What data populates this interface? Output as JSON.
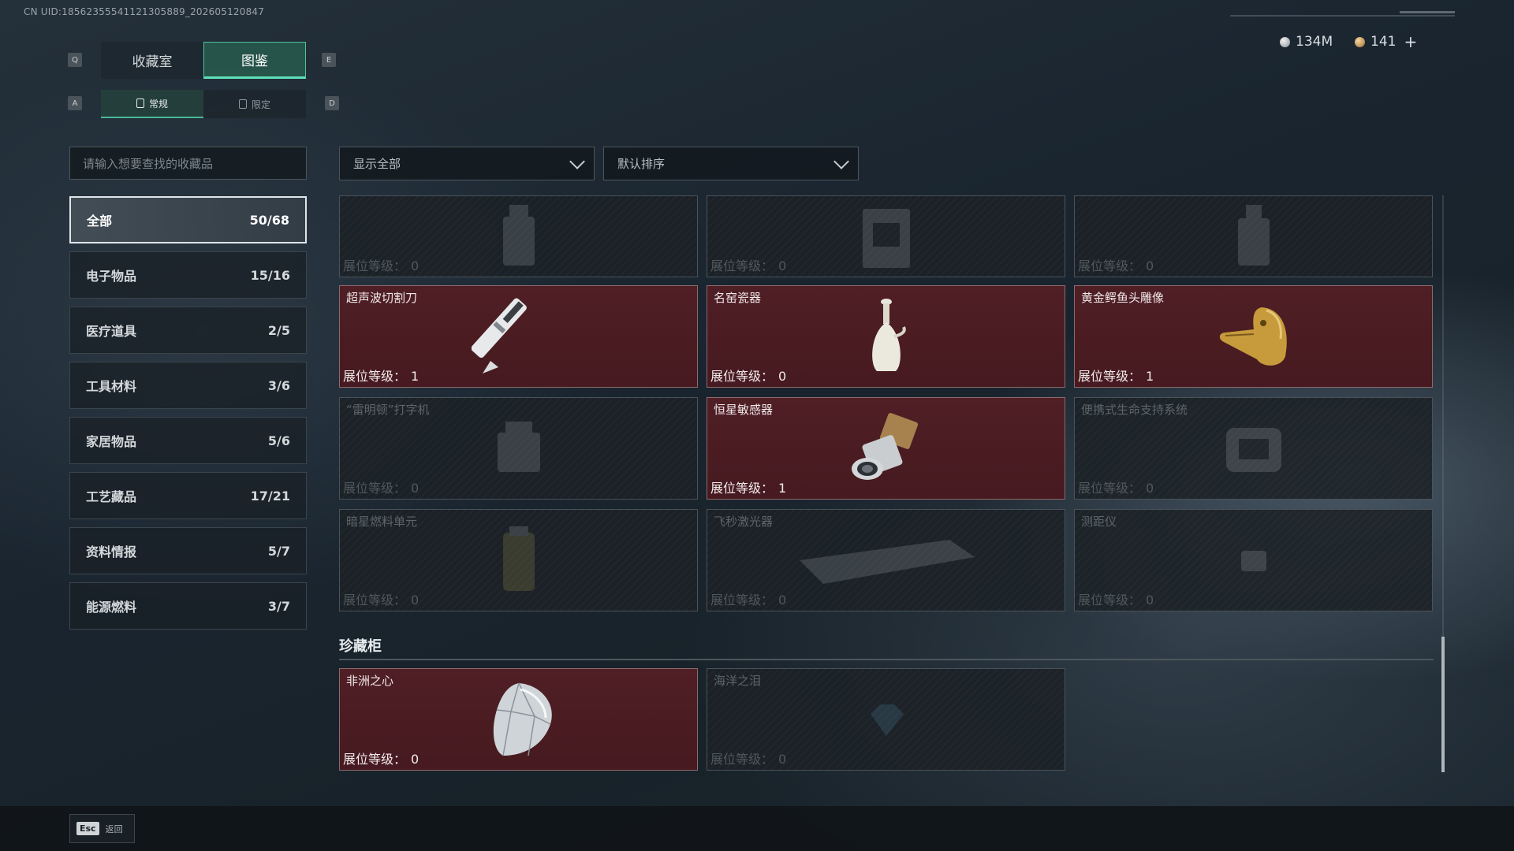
{
  "uid_text": "CN UID:185623555411213058​89_202605120847",
  "currency": {
    "silver": {
      "icon": "silver-coin-icon",
      "value": "134M"
    },
    "gold": {
      "icon": "gold-coin-icon",
      "value": "141",
      "add_label": "+"
    }
  },
  "tabs": {
    "left_key": "Q",
    "right_key": "E",
    "items": [
      {
        "label": "收藏室",
        "active": false
      },
      {
        "label": "图鉴",
        "active": true
      }
    ]
  },
  "subtabs": {
    "left_key": "A",
    "right_key": "D",
    "items": [
      {
        "label": "常规",
        "icon": "regular-icon",
        "active": true
      },
      {
        "label": "限定",
        "icon": "limited-icon",
        "active": false
      }
    ]
  },
  "search": {
    "placeholder": "请输入想要查找的收藏品"
  },
  "categories": [
    {
      "label": "全部",
      "count": "50/68",
      "active": true
    },
    {
      "label": "电子物品",
      "count": "15/16",
      "active": false
    },
    {
      "label": "医疗道具",
      "count": "2/5",
      "active": false
    },
    {
      "label": "工具材料",
      "count": "3/6",
      "active": false
    },
    {
      "label": "家居物品",
      "count": "5/6",
      "active": false
    },
    {
      "label": "工艺藏品",
      "count": "17/21",
      "active": false
    },
    {
      "label": "资料情报",
      "count": "5/7",
      "active": false
    },
    {
      "label": "能源燃料",
      "count": "3/7",
      "active": false
    }
  ],
  "filters": {
    "show": "显示全部",
    "sort": "默认排序"
  },
  "level_label": "展位等级：",
  "grid_items": [
    {
      "name": "",
      "level": "0",
      "owned": false,
      "art": "bottle-icon"
    },
    {
      "name": "",
      "level": "0",
      "owned": false,
      "art": "device-icon"
    },
    {
      "name": "",
      "level": "0",
      "owned": false,
      "art": "bottle-icon"
    },
    {
      "name": "超声波切割刀",
      "level": "1",
      "owned": true,
      "art": "ultrasonic-knife-icon"
    },
    {
      "name": "名窑瓷器",
      "level": "0",
      "owned": true,
      "art": "porcelain-vase-icon"
    },
    {
      "name": "黄金鳄鱼头雕像",
      "level": "1",
      "owned": true,
      "art": "golden-crocodile-icon"
    },
    {
      "name": "“雷明顿”打字机",
      "level": "0",
      "owned": false,
      "art": "typewriter-icon"
    },
    {
      "name": "恒星敏感器",
      "level": "1",
      "owned": true,
      "art": "star-sensor-icon"
    },
    {
      "name": "便携式生命支持系统",
      "level": "0",
      "owned": false,
      "art": "life-support-icon"
    },
    {
      "name": "暗星燃料单元",
      "level": "0",
      "owned": false,
      "art": "fuel-cell-icon"
    },
    {
      "name": "飞秒激光器",
      "level": "0",
      "owned": false,
      "art": "laser-icon"
    },
    {
      "name": "测距仪",
      "level": "0",
      "owned": false,
      "art": "rangefinder-icon"
    }
  ],
  "treasure_section": {
    "title": "珍藏柜",
    "items": [
      {
        "name": "非洲之心",
        "level": "0",
        "owned": true,
        "art": "diamond-icon"
      },
      {
        "name": "海洋之泪",
        "level": "0",
        "owned": false,
        "art": "gem-icon"
      }
    ]
  },
  "footer": {
    "key": "Esc",
    "label": "返回"
  }
}
